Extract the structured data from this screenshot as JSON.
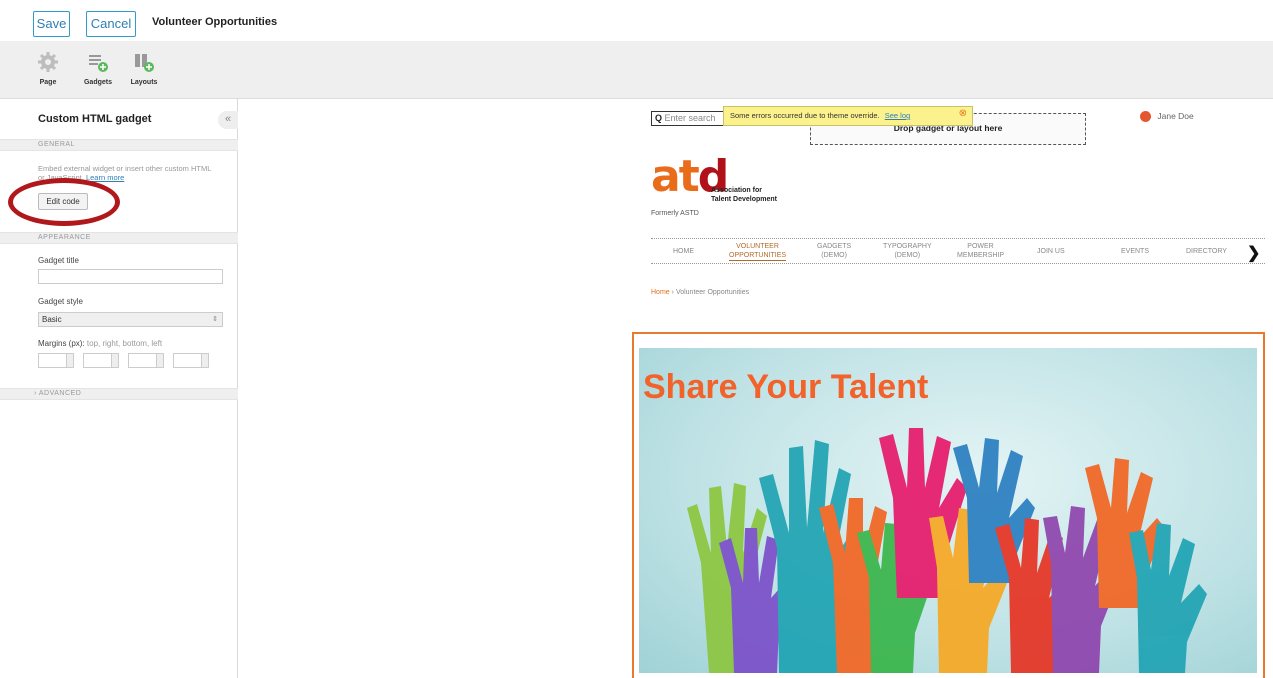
{
  "topbar": {
    "save_label": "Save",
    "cancel_label": "Cancel",
    "page_name": "Volunteer Opportunities"
  },
  "toolbar": {
    "page_label": "Page",
    "gadgets_label": "Gadgets",
    "layouts_label": "Layouts"
  },
  "panel": {
    "title": "Custom HTML gadget",
    "collapse_glyph": "«",
    "general_header": "GENERAL",
    "description": "Embed external widget or insert other custom HTML or JavaScript.",
    "learn_more": "Learn more",
    "edit_code_label": "Edit code",
    "appearance_header": "APPEARANCE",
    "gadget_title_label": "Gadget title",
    "gadget_title_value": "",
    "gadget_style_label": "Gadget style",
    "gadget_style_value": "Basic",
    "margins_label": "Margins (px):",
    "margins_hint": "top, right, bottom, left",
    "advanced_header": "› ADVANCED"
  },
  "site": {
    "search_placeholder": "Enter search",
    "dropzone_text": "Drop gadget or layout here",
    "error_text": "Some errors occurred due to theme override.",
    "error_link": "See log",
    "user_name": "Jane Doe",
    "logo_at": "at",
    "logo_d": "d",
    "assoc_line1": "Association for",
    "assoc_line2": "Talent Development",
    "formerly": "Formerly ASTD",
    "nav": {
      "home": "HOME",
      "volunteer_1": "VOLUNTEER",
      "volunteer_2": "OPPORTUNITIES",
      "gadgets_1": "GADGETS",
      "gadgets_2": "(DEMO)",
      "typography_1": "TYPOGRAPHY",
      "typography_2": "(DEMO)",
      "power_1": "POWER",
      "power_2": "MEMBERSHIP",
      "join": "JOIN US",
      "events": "EVENTS",
      "directory": "DIRECTORY"
    },
    "breadcrumb_home": "Home",
    "breadcrumb_sep": "›",
    "breadcrumb_current": "Volunteer Opportunities",
    "banner_title": "Share Your Talent"
  },
  "colors": {
    "accent": "#2f9bc9",
    "highlight": "#b0181b",
    "brand_orange": "#e86c1a",
    "brand_red": "#b1121a"
  }
}
